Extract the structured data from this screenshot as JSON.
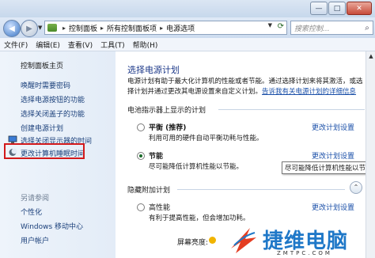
{
  "window": {
    "controls": {
      "minimize": "—",
      "maximize": "□",
      "close": "✕"
    }
  },
  "nav": {
    "breadcrumbs": [
      "控制面板",
      "所有控制面板项",
      "电源选项"
    ],
    "search_placeholder": "搜索控制...",
    "icons": {
      "back": "back-arrow-icon",
      "forward": "forward-arrow-icon",
      "refresh": "refresh-icon",
      "search": "search-icon"
    }
  },
  "menu": {
    "items": [
      "文件(F)",
      "编辑(E)",
      "查看(V)",
      "工具(T)",
      "帮助(H)"
    ]
  },
  "sidebar": {
    "home": "控制面板主页",
    "links": [
      "唤醒时需要密码",
      "选择电源按钮的功能",
      "选择关闭盖子的功能",
      "创建电源计划",
      "选择关闭显示器的时间",
      "更改计算机睡眠时间"
    ],
    "see_also_title": "另请参阅",
    "see_also": [
      "个性化",
      "Windows 移动中心",
      "用户帐户"
    ]
  },
  "main": {
    "heading": "选择电源计划",
    "description": "电源计划有助于最大化计算机的性能或者节能。通过选择计划来将其激活，或选择计划并通过更改其电源设置来自定义计划。",
    "learn_more": "告诉我有关电源计划的详细信息",
    "section1_title": "电池指示器上显示的计划",
    "plans": [
      {
        "name": "平衡 (推荐)",
        "desc": "利用可用的硬件自动平衡功耗与性能。",
        "link": "更改计划设置",
        "selected": false
      },
      {
        "name": "节能",
        "desc": "尽可能降低计算机性能以节能。",
        "link": "更改计划设置",
        "selected": true
      }
    ],
    "section2_title": "隐藏附加计划",
    "extra_plans": [
      {
        "name": "高性能",
        "desc": "有利于提高性能，但会增加功耗。",
        "link": "更改计划设置",
        "selected": false
      }
    ],
    "tooltip": "尽可能降低计算机性能以节能。",
    "brightness_label": "屏幕亮度:"
  },
  "watermark": {
    "text": "捷维电脑",
    "url": "ZMTPC.COM"
  }
}
